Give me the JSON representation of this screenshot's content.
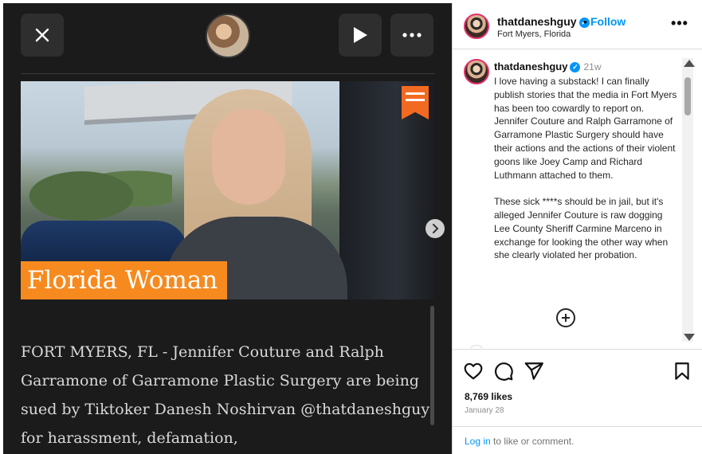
{
  "media": {
    "photo_caption": "Florida Woman",
    "article_text": "FORT MYERS, FL - Jennifer Couture and Ralph Garramone of Garramone Plastic Surgery are being sued by Tiktoker Danesh Noshirvan @thatdaneshguy for harassment, defamation,"
  },
  "header": {
    "username": "thatdaneshguy",
    "separator": "•",
    "follow_label": "Follow",
    "location": "Fort Myers, Florida",
    "more_label": "•••"
  },
  "caption": {
    "username": "thatdaneshguy",
    "time_ago": "21w",
    "text": "I love having a substack! I can finally publish stories that the media in Fort Myers has been too cowardly to report on. Jennifer Couture and Ralph Garramone of Garramone Plastic Surgery should have their actions and the actions of their violent goons like Joey Camp and Richard Luthmann attached to them.\n\nThese sick ****s should be in jail, but it's alleged Jennifer Couture is raw dogging Lee County Sheriff Carmine Marceno in exchange for looking the other way when she clearly violated her probation."
  },
  "actions": {
    "likes": "8,769 likes",
    "date": "January 28",
    "login_link": "Log in",
    "login_suffix": " to like or comment."
  },
  "colors": {
    "accent_blue": "#0095f6",
    "caption_orange": "#f68a1f",
    "media_bg": "#1b1b1b"
  },
  "icons": {
    "close": "close-icon",
    "play": "play-icon",
    "more": "more-icon",
    "next": "chevron-right-icon",
    "verified": "verified-badge-icon",
    "like": "heart-icon",
    "comment": "comment-icon",
    "share": "paper-plane-icon",
    "save": "bookmark-icon",
    "load_more": "plus-circle-icon"
  }
}
